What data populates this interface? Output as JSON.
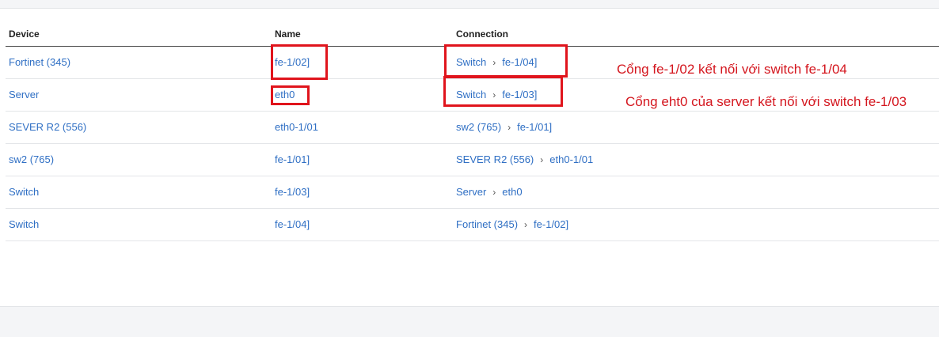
{
  "table": {
    "headers": {
      "device": "Device",
      "name": "Name",
      "connection": "Connection"
    },
    "rows": [
      {
        "device": "Fortinet (345)",
        "name": "fe-1/02]",
        "conn_device": "Switch",
        "conn_port": "fe-1/04]"
      },
      {
        "device": "Server",
        "name": "eth0",
        "conn_device": "Switch",
        "conn_port": "fe-1/03]"
      },
      {
        "device": "SEVER R2 (556)",
        "name": "eth0-1/01",
        "conn_device": "sw2 (765)",
        "conn_port": "fe-1/01]"
      },
      {
        "device": "sw2 (765)",
        "name": "fe-1/01]",
        "conn_device": "SEVER R2 (556)",
        "conn_port": "eth0-1/01"
      },
      {
        "device": "Switch",
        "name": "fe-1/03]",
        "conn_device": "Server",
        "conn_port": "eth0"
      },
      {
        "device": "Switch",
        "name": "fe-1/04]",
        "conn_device": "Fortinet (345)",
        "conn_port": "fe-1/02]"
      }
    ],
    "separator_icon": "chevron-right-icon"
  },
  "annotations": {
    "note1": "Cổng fe-1/02 kết nối với switch fe-1/04",
    "note2": "Cổng eht0 của server kết nối với switch fe-1/03",
    "color": "#e0141c"
  },
  "colors": {
    "link": "#2f6fc4",
    "header_text": "#222222"
  }
}
